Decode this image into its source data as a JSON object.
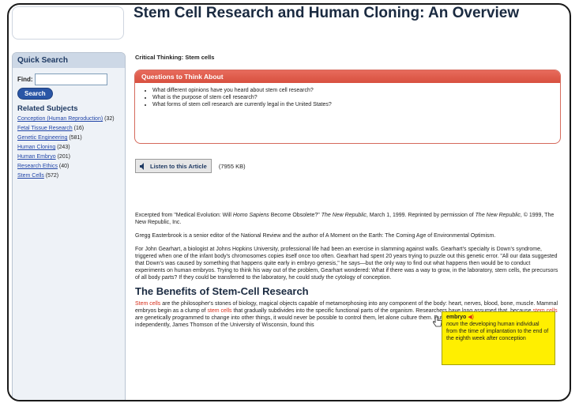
{
  "page": {
    "title": "Stem Cell Research and Human Cloning: An Overview",
    "critical_thinking": "Critical Thinking: Stem cells"
  },
  "sidebar": {
    "quick_search_title": "Quick Search",
    "find_label": "Find:",
    "search_value": "",
    "search_button": "Search",
    "related_title": "Related Subjects",
    "subjects": [
      {
        "label": "Conception (Human Reproduction)",
        "count": "(32)"
      },
      {
        "label": "Fetal Tissue Research",
        "count": "(16)"
      },
      {
        "label": "Genetic Engineering",
        "count": "(581)"
      },
      {
        "label": "Human Cloning",
        "count": "(243)"
      },
      {
        "label": "Human Embryo",
        "count": "(201)"
      },
      {
        "label": "Research Ethics",
        "count": "(40)"
      },
      {
        "label": "Stem Cells",
        "count": "(572)"
      }
    ]
  },
  "questions": {
    "heading": "Questions to Think About",
    "items": [
      "What different opinions have you heard about stem cell research?",
      "What is the purpose of stem cell research?",
      "What forms of stem cell research are currently legal in the United States?"
    ]
  },
  "audio": {
    "button": "Listen to this Article",
    "size": "(7955 KB)"
  },
  "article": {
    "p1_a": "Excerpted from \"Medical Evolution: Will ",
    "p1_em": "Homo Sapiens",
    "p1_b": " Become Obsolete?\" ",
    "p1_em2": "The New Republic",
    "p1_c": ", March 1, 1999. Reprinted by permission of ",
    "p1_em3": "The New Republic",
    "p1_d": ", © 1999, The New Republic, Inc.",
    "p2": "Gregg Easterbrook is a senior editor of the National Review and the author of A Moment on the Earth: The Coming Age of Environmental Optimism.",
    "p3": "For John Gearhart, a biologist at Johns Hopkins University, professional life had been an exercise in slamming against walls. Gearhart's specialty is Down's syndrome, triggered when one of the infant body's chromosomes copies itself once too often. Gearhart had spent 20 years trying to puzzle out this genetic error. \"All our data suggested that Down's was caused by something that happens quite early in embryo genesis,\" he says—but the only way to find out what happens then would be to conduct experiments on human embryos. Trying to think his way out of the problem, Gearhart wondered: What if there was a way to grow, in the laboratory, stem cells, the precursors of all body parts? If they could be transferred to the laboratory, he could study the cytology of conception.",
    "section_title": "The Benefits of Stem-Cell Research",
    "p4_hl": "Stem cells",
    "p4_a": " are the philosopher's stones of biology, magical objects capable of metamorphosing into any component of the body: heart, nerves, blood, bone, muscle. Mammal embryos begin as a clump of ",
    "p4_hl2": "stem cells",
    "p4_b": " that gradually subdivides into the specific functional parts of the organism. Researchers have long assumed that, because ",
    "p4_hl3": "stem cells",
    "p4_c": " are genetically programmed to change into other things, it would never be possible to control them, let alone culture them. But Gearhart and another researcher working independently, James Thomson of the University of Wisconsin, found this"
  },
  "tooltip": {
    "word": "embryo",
    "pos": "noun",
    "definition": "the developing human individual from the time of implantation to the end of the eighth week after conception"
  },
  "colors": {
    "accent_red": "#d8503f",
    "link_blue": "#2145a8",
    "tooltip_yellow": "#ffef00"
  }
}
